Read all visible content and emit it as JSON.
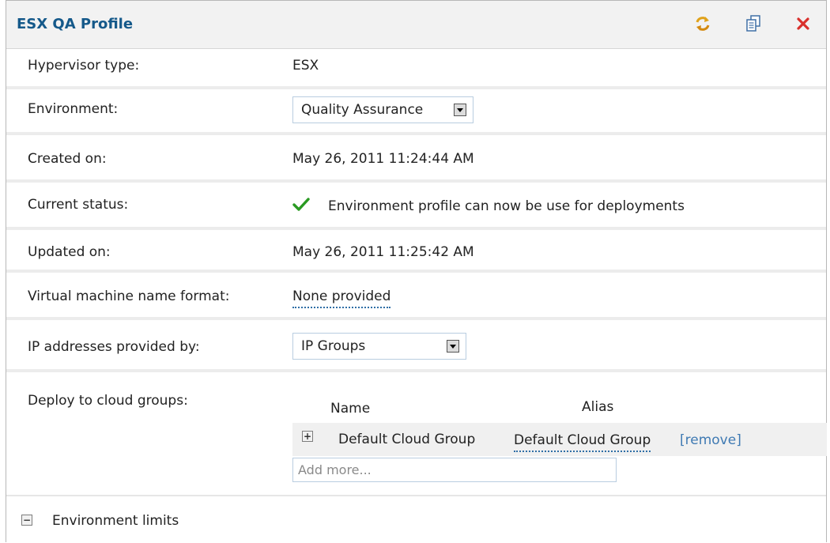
{
  "window": {
    "title": "ESX QA Profile",
    "toolbar": {
      "refresh_icon": "refresh-icon",
      "clone_icon": "clone-icon",
      "delete_icon": "delete-icon"
    }
  },
  "fields": {
    "hypervisor": {
      "label": "Hypervisor type:",
      "value": "ESX"
    },
    "environment": {
      "label": "Environment:",
      "selected": "Quality Assurance"
    },
    "created": {
      "label": "Created on:",
      "value": "May 26, 2011 11:24:44 AM"
    },
    "status": {
      "label": "Current status:",
      "value": "Environment profile can now be use for deployments",
      "icon": "checkmark-icon",
      "icon_color": "#2a9a22"
    },
    "updated": {
      "label": "Updated on:",
      "value": "May 26, 2011 11:25:42 AM"
    },
    "vm_name_format": {
      "label": "Virtual machine name format:",
      "value": "None provided"
    },
    "ip_provider": {
      "label": "IP addresses provided by:",
      "selected": "IP Groups"
    }
  },
  "cloud_groups": {
    "label": "Deploy to cloud groups:",
    "columns": {
      "name": "Name",
      "alias": "Alias"
    },
    "rows": [
      {
        "name": "Default Cloud Group",
        "alias": "Default Cloud Group",
        "remove_label": "[remove]"
      }
    ],
    "add_placeholder": "Add more..."
  },
  "limits": {
    "label": "Environment limits"
  },
  "colors": {
    "title": "#15598a",
    "link": "#3f7ab3",
    "delete": "#d9302c"
  }
}
